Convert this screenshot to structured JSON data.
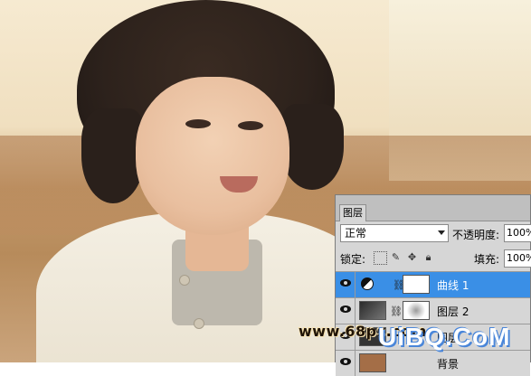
{
  "panel": {
    "tab_label": "图层",
    "blend_mode": "正常",
    "opacity_label": "不透明度:",
    "opacity_value": "100%",
    "lock_label": "锁定:",
    "fill_label": "填充:",
    "fill_value": "100%",
    "layers": [
      {
        "name": "曲线 1",
        "selected": true,
        "thumb_color": "#ffffff"
      },
      {
        "name": "图层 2",
        "selected": false,
        "thumb_color": "#444444"
      },
      {
        "name": "图层",
        "selected": false,
        "thumb_color": "#333333"
      },
      {
        "name": "背景",
        "selected": false,
        "thumb_color": "#a46e47"
      }
    ]
  },
  "watermark": {
    "left_text": "www.68ps.com",
    "right_text": "UiBQ.CoM"
  },
  "colors": {
    "selection_blue": "#3a8fe6",
    "watermark_blue": "#4a86d9"
  }
}
